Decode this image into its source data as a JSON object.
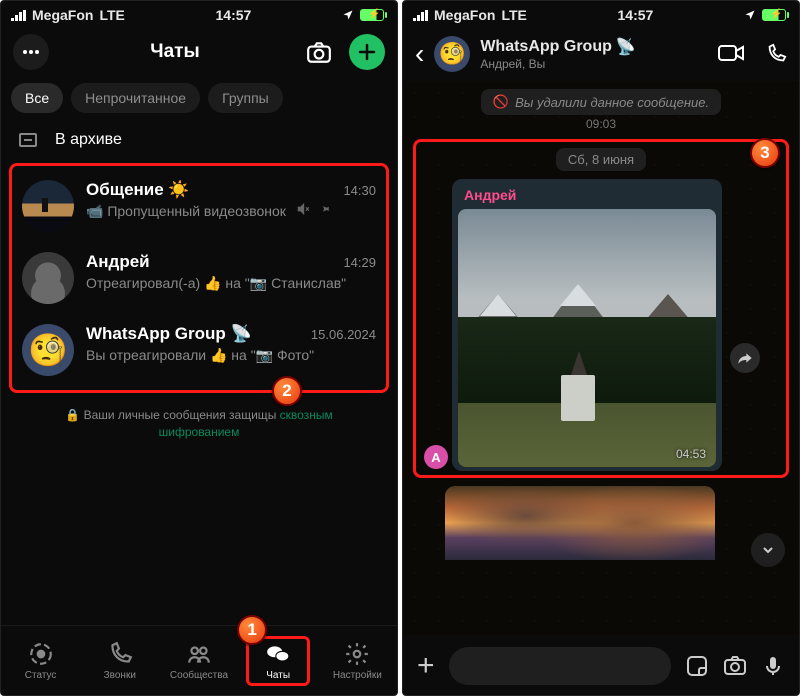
{
  "status": {
    "carrier": "MegaFon",
    "net": "LTE",
    "time": "14:57"
  },
  "left": {
    "title": "Чаты",
    "filters": {
      "all": "Все",
      "unread": "Непрочитанное",
      "groups": "Группы"
    },
    "archive": "В архиве",
    "chats": [
      {
        "name": "Общение ☀️",
        "time": "14:30",
        "sub_prefix": "📹",
        "sub": "Пропущенный видеозвонок"
      },
      {
        "name": "Андрей",
        "time": "14:29",
        "sub": "Отреагировал(-а) 👍 на \"📷 Станислав\""
      },
      {
        "name": "WhatsApp Group 📡",
        "time": "15.06.2024",
        "sub": "Вы отреагировали 👍 на \"📷 Фото\""
      }
    ],
    "encryption_a": "Ваши личные сообщения защищ",
    "encryption_b": "ы ",
    "encryption_link": "сквозным шифрованием",
    "tabs": {
      "status": "Статус",
      "calls": "Звонки",
      "communities": "Сообщества",
      "chats": "Чаты",
      "settings": "Настройки"
    },
    "badge1": "1",
    "badge2": "2"
  },
  "right": {
    "group_name": "WhatsApp Group",
    "group_members": "Андрей, Вы",
    "deleted": "Вы удалили данное сообщение.",
    "deleted_time": "09:03",
    "date": "Сб, 8 июня",
    "sender": "Андрей",
    "msg_time": "04:53",
    "sender_initial": "A",
    "badge3": "3"
  }
}
